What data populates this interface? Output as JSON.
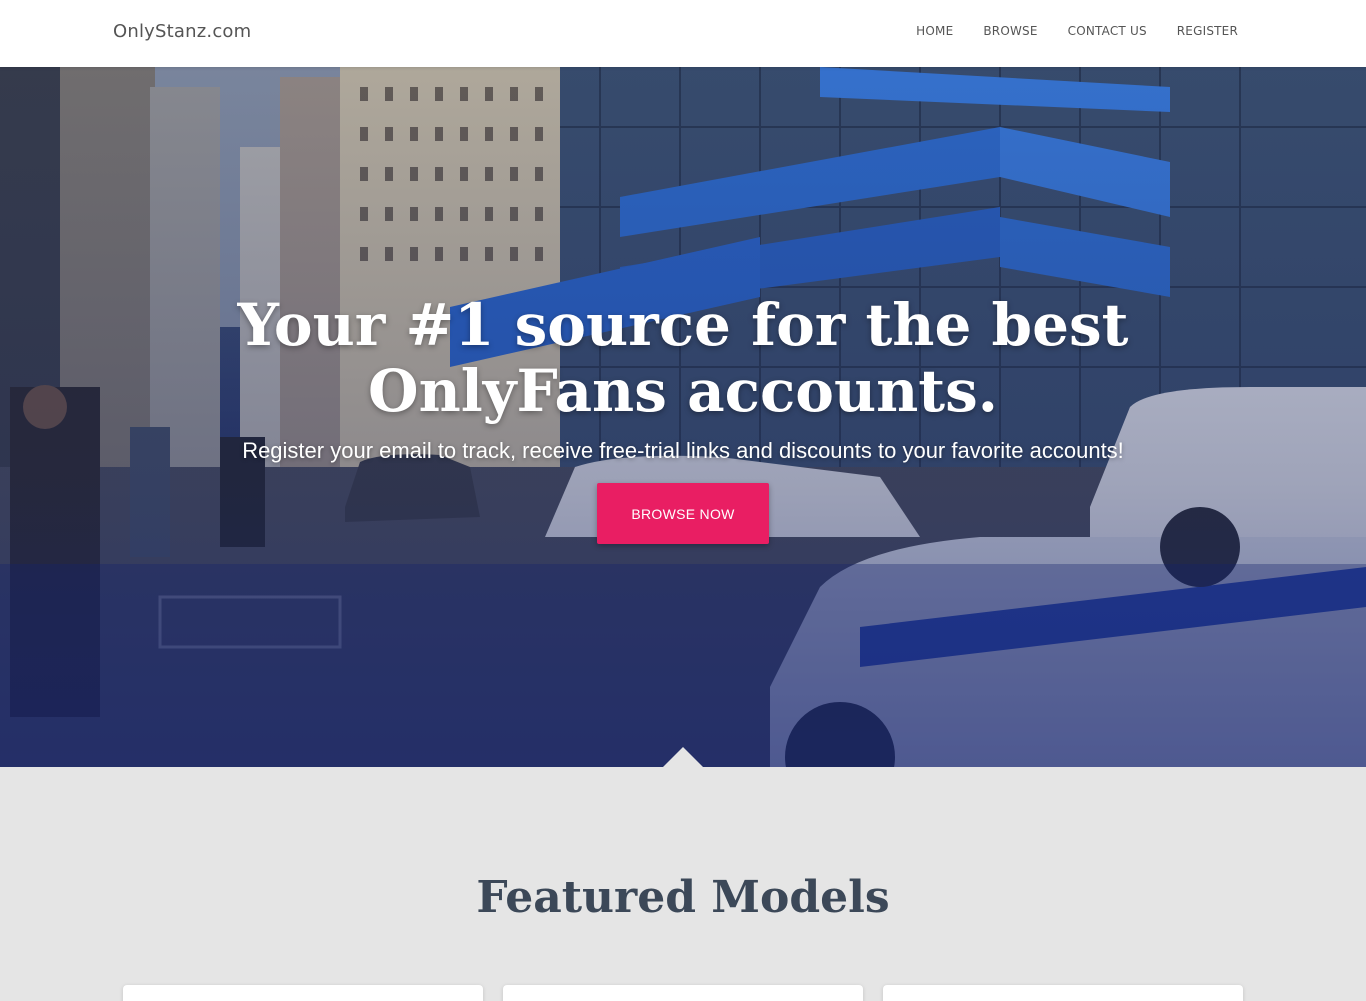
{
  "navbar": {
    "brand": "OnlyStanz.com",
    "links": [
      "HOME",
      "BROWSE",
      "CONTACT US",
      "REGISTER"
    ]
  },
  "hero": {
    "headline": "Your #1 source for the best OnlyFans accounts.",
    "subheadline": "Register your email to track, receive free-trial links and discounts to your favorite accounts!",
    "cta_label": "BROWSE NOW"
  },
  "featured": {
    "title": "Featured Models",
    "cards": 3
  },
  "colors": {
    "accent": "#e91e63",
    "hero_overlay": "#1d2d6a",
    "section_bg": "#e5e5e5",
    "heading_text": "#3c4858"
  }
}
